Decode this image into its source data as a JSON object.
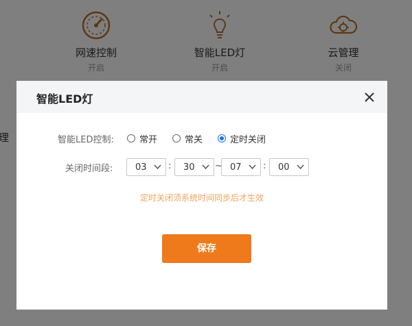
{
  "background": {
    "features": [
      {
        "name": "网速控制",
        "status": "开启",
        "icon": "speedometer-icon"
      },
      {
        "name": "智能LED灯",
        "status": "开启",
        "icon": "lightbulb-icon"
      },
      {
        "name": "云管理",
        "status": "关闭",
        "icon": "cloud-gear-icon"
      }
    ],
    "side_text": "理"
  },
  "modal": {
    "title": "智能LED灯",
    "close_icon": "close-icon",
    "led_control": {
      "label": "智能LED控制:",
      "options": [
        "常开",
        "常关",
        "定时关闭"
      ],
      "selected": "定时关闭"
    },
    "time_period": {
      "label": "关闭时间段:",
      "start_hour": "03",
      "start_min": "30",
      "end_hour": "07",
      "end_min": "00",
      "colon": ":",
      "tilde": "~"
    },
    "hint": "定时关闭须系统时间同步后才生效",
    "save_label": "保存"
  },
  "colors": {
    "accent": "#ee7a1b",
    "icon_brown": "#b8702e",
    "hint_orange": "#f0a35e",
    "radio_blue": "#1a73e8"
  }
}
